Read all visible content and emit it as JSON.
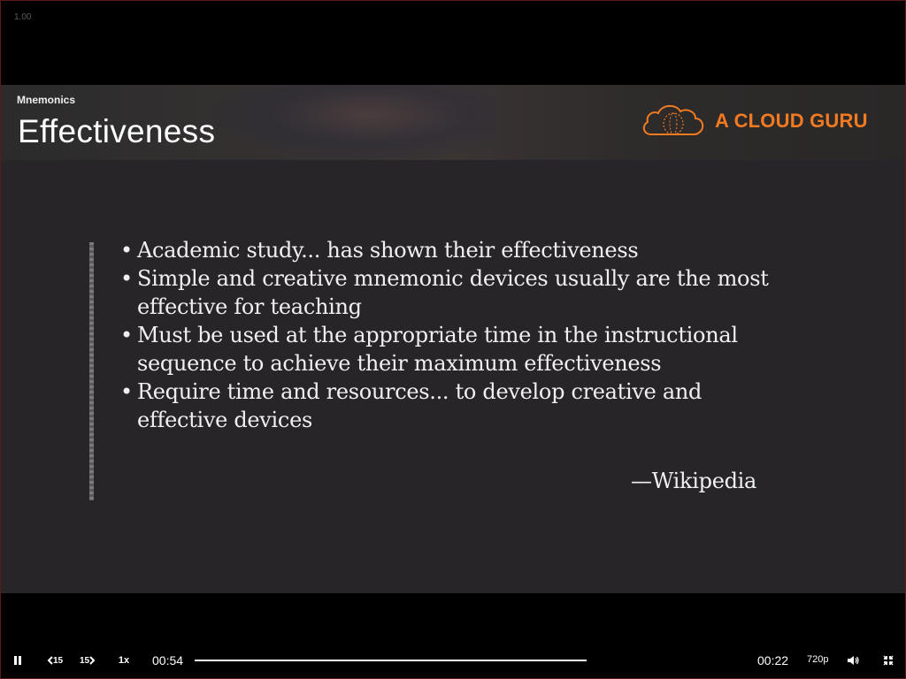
{
  "player": {
    "speed_badge": "1.00",
    "controls": {
      "skip_back_label": "15",
      "skip_forward_label": "15",
      "playback_rate": "1x",
      "elapsed_time": "00:54",
      "remaining_time": "00:22",
      "quality": "720p",
      "progress_fraction": 1.0
    }
  },
  "slide": {
    "subtitle": "Mnemonics",
    "title": "Effectiveness",
    "logo_text": "A CLOUD GURU",
    "bullets": [
      "Academic study... has shown their effectiveness",
      "Simple and creative mnemonic devices usually are the most effective for teaching",
      "Must be used at the appropriate time in the instructional sequence to achieve their maximum effectiveness",
      "Require time and resources... to develop creative and effective devices"
    ],
    "attribution": "—Wikipedia"
  },
  "colors": {
    "brand_orange": "#f27a21",
    "slide_background": "#282528"
  }
}
